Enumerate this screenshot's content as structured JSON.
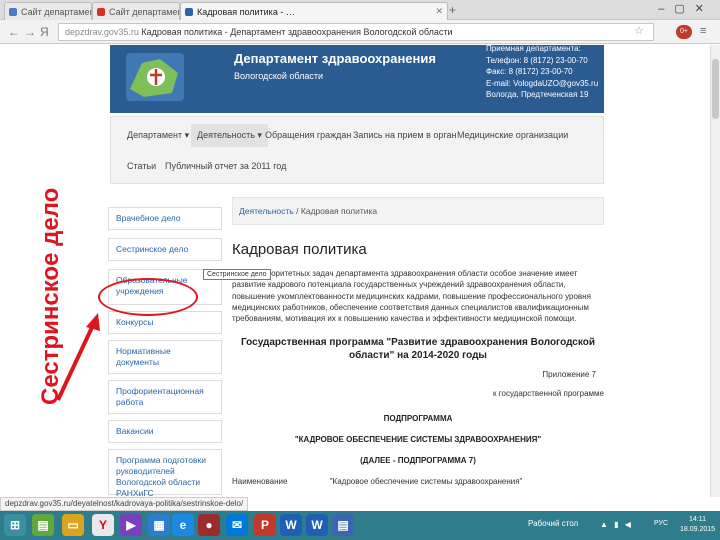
{
  "browser": {
    "tabs": [
      {
        "label": "Сайт департамента з…",
        "color": "#4a7bc8"
      },
      {
        "label": "Сайт департамента з…",
        "color": "#d93025"
      },
      {
        "label": "Кадровая политика - …",
        "color": "#2a66a8"
      }
    ],
    "url_host": "depzdrav.gov35.ru",
    "url_rest": " Кадровая политика - Департамент здравоохранения Вологодской области",
    "ext_badge": "0+"
  },
  "header": {
    "title": "Департамент здравоохранения",
    "subtitle": "Вологодской области",
    "contacts": [
      "Приемная департамента:",
      "Телефон: 8 (8172) 23-00-70",
      "Факс: 8 (8172) 23-00-70",
      "E-mail: VologdaUZO@gov35.ru",
      "Вологда, Предтеченская 19"
    ]
  },
  "nav": {
    "row1": [
      "Департамент ▾",
      "Деятельность ▾",
      "Обращения граждан",
      "Запись на прием в орган",
      "Медицинские организации"
    ],
    "row2": [
      "Статьи",
      "Публичный отчет за 2011 год"
    ]
  },
  "sidebar": [
    "Врачебное дело",
    "Сестринское дело",
    "Образовательные учреждения",
    "Конкурсы",
    "Нормативные документы",
    "Профориентационная работа",
    "Вакансии",
    "Программа подготовки руководителей Вологодской области РАНХиГС"
  ],
  "breadcrumb": {
    "link": "Деятельность",
    "sep": " / ",
    "current": "Кадровая политика"
  },
  "tooltip": "Сестринское дело",
  "content": {
    "title": "Кадровая политика",
    "text": "Среди приоритетных задач департамента здравоохранения области особое значение имеет развитие кадрового потенциала государственных учреждений здравоохранения области, повышение укомплектованности медицинских кадрами, повышение профессионального уровня медицинских работников, обеспечение соответствия данных специалистов квалификационным требованиям, мотивация их к повышению качества и эффективности медицинской помощи.",
    "program": "Государственная программа \"Развитие здравоохранения Вологодской области\" на 2014-2020 годы",
    "appendix": "Приложение 7",
    "appendix2": "к государственной программе",
    "sub": "ПОДПРОГРАММА",
    "sub_title": "\"КАДРОВОЕ ОБЕСПЕЧЕНИЕ СИСТЕМЫ ЗДРАВООХРАНЕНИЯ\"",
    "sub_note": "(ДАЛЕЕ - ПОДПРОГРАММА 7)",
    "last_left": "Наименование",
    "last_right": "\"Кадровое обеспечение системы здравоохранения\""
  },
  "annotation": {
    "vertical_label": "Сестринское дело",
    "color": "#e0141c"
  },
  "status_url": "depzdrav.gov35.ru/deyatelnost/kadrovaya-politika/sestrinskoe-delo/",
  "taskbar": {
    "label": "Рабочий стол",
    "tray": "▲ ▮ ◀",
    "lang": "РУС",
    "time": "14:11",
    "date": "18.09.2015"
  }
}
